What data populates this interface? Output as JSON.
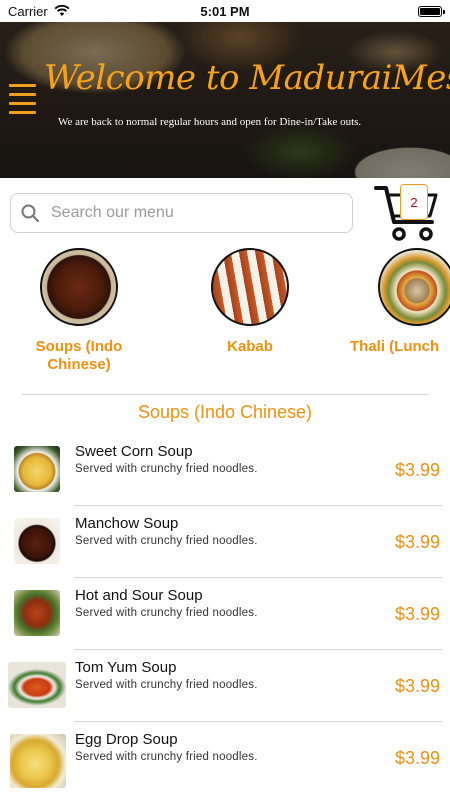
{
  "status_bar": {
    "carrier": "Carrier",
    "time": "5:01 PM"
  },
  "hero": {
    "title": "Welcome to MaduraiMes",
    "subtitle": "We are back to normal regular hours and open for Dine-in/Take outs."
  },
  "search": {
    "placeholder": "Search our menu",
    "value": ""
  },
  "cart": {
    "count": "2"
  },
  "categories": [
    {
      "label": "Soups (Indo Chinese)",
      "icon": "soup-bowl-image"
    },
    {
      "label": "Kabab",
      "icon": "kabab-skewers-image"
    },
    {
      "label": "Thali (Lunch",
      "icon": "thali-plate-image"
    }
  ],
  "section": {
    "title": "Soups (Indo Chinese)"
  },
  "items": [
    {
      "name": "Sweet Corn Soup",
      "description": "Served with crunchy fried noodles.",
      "price": "$3.99"
    },
    {
      "name": "Manchow Soup",
      "description": "Served with crunchy fried noodles.",
      "price": "$3.99"
    },
    {
      "name": "Hot and Sour Soup",
      "description": "Served with crunchy fried noodles.",
      "price": "$3.99"
    },
    {
      "name": "Tom Yum Soup",
      "description": "Served with crunchy fried noodles.",
      "price": "$3.99"
    },
    {
      "name": "Egg Drop Soup",
      "description": "Served with crunchy fried noodles.",
      "price": "$3.99"
    }
  ],
  "colors": {
    "accent": "#f0900c",
    "badge_text": "#d0021b"
  }
}
